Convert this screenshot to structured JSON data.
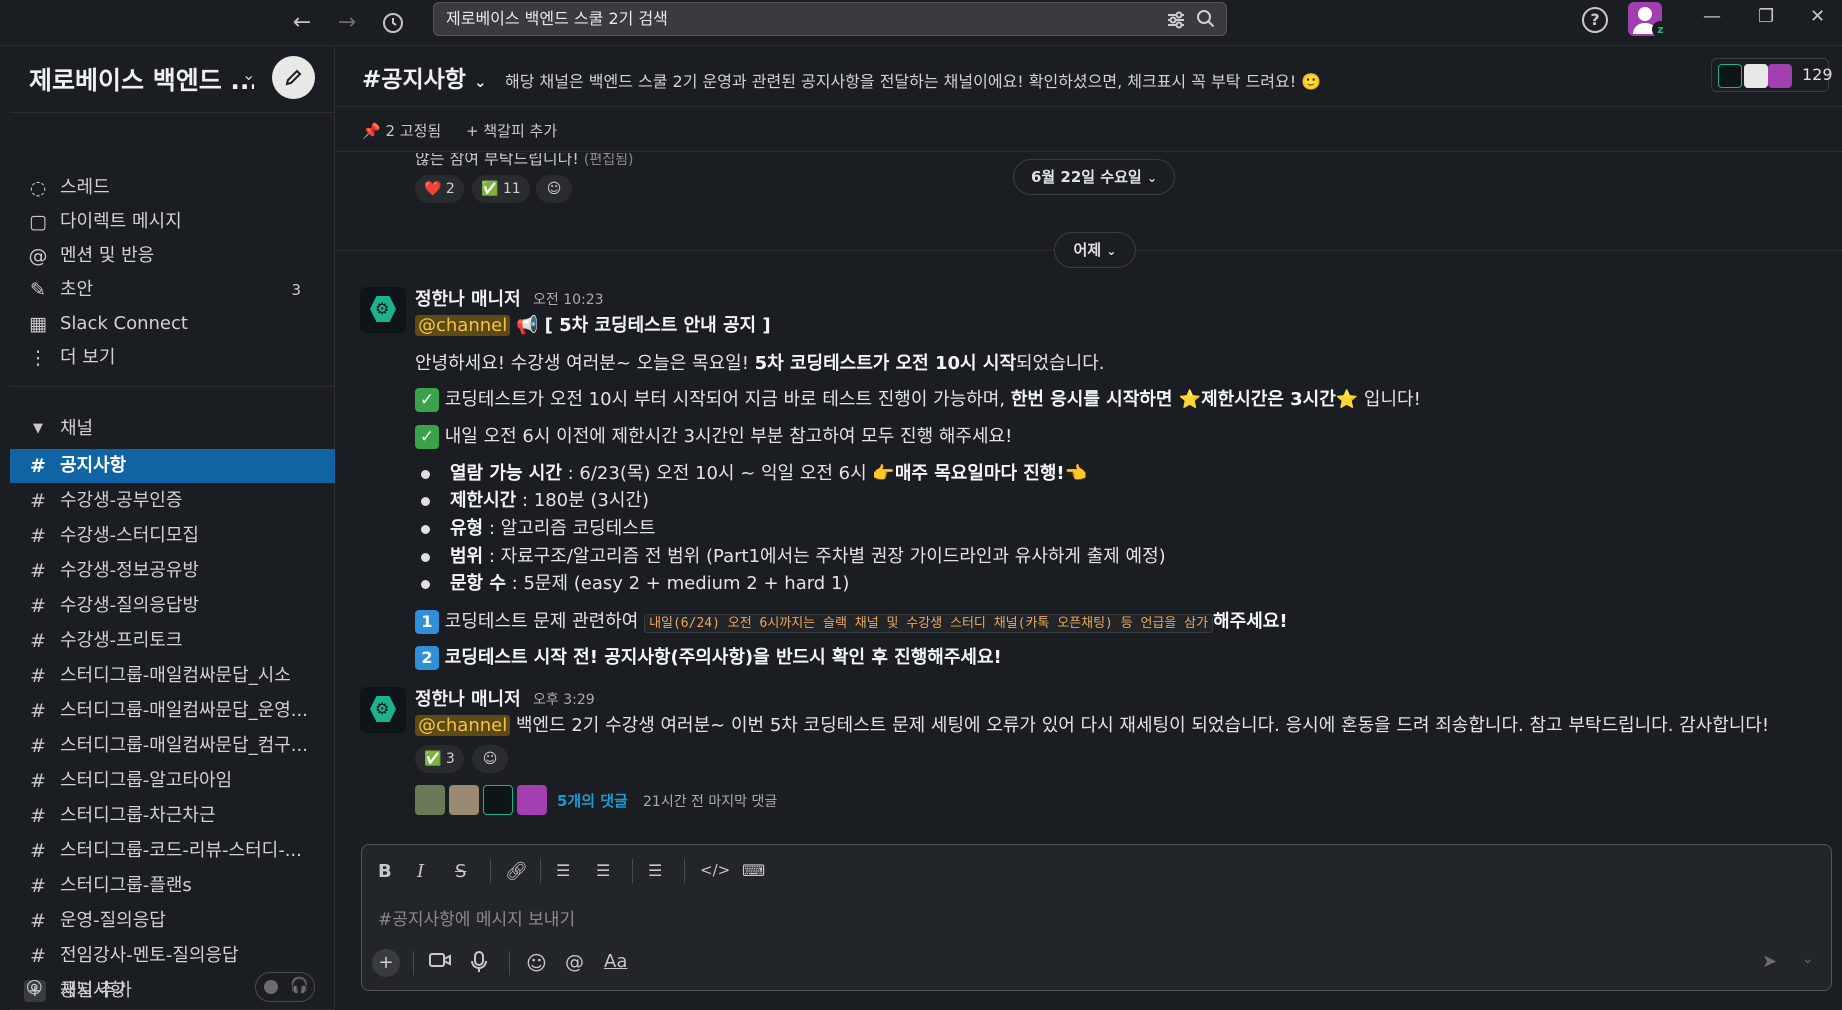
{
  "search": {
    "placeholder": "제로베이스 백엔드 스쿨 2기 검색"
  },
  "workspace": {
    "name": "제로베이스 백엔드 ..."
  },
  "sidebar": {
    "top_items": [
      {
        "label": "스레드"
      },
      {
        "label": "다이렉트 메시지"
      },
      {
        "label": "멘션 및 반응"
      },
      {
        "label": "초안",
        "count": "3"
      },
      {
        "label": "Slack Connect"
      },
      {
        "label": "더 보기"
      }
    ],
    "channels_header": "채널",
    "channels": [
      "공지사항",
      "수강생-공부인증",
      "수강생-스터디모집",
      "수강생-정보공유방",
      "수강생-질의응답방",
      "수강생-프리토크",
      "스터디그룹-매일컴싸문답_시소",
      "스터디그룹-매일컴싸문답_운영...",
      "스터디그룹-매일컴싸문답_컴구...",
      "스터디그룹-알고타아임",
      "스터디그룹-차근차근",
      "스터디그룹-코드-리뷰-스터디-...",
      "스터디그룹-플랜s",
      "운영-질의응답",
      "전임강사-멘토-질의응답"
    ],
    "add_channel": "채널 추가",
    "huddle_label": "공지사항"
  },
  "header": {
    "channel_name": "공지사항",
    "topic": "해당 채널은 백엔드 스쿨 2기 운영과 관련된 공지사항을 전달하는 채널이에요! 확인하셨으면, 체크표시 꼭 부탁 드려요! 🙂",
    "member_count": "129",
    "pinned": "2 고정됨",
    "add_bookmark": "책갈피 추가"
  },
  "messages": {
    "prev_tail": "않는 참여 부탁드립니다!",
    "prev_edited": "(편집됨)",
    "prev_reactions": [
      {
        "emoji": "❤️",
        "count": "2"
      },
      {
        "emoji": "✅",
        "count": "11"
      }
    ],
    "date_pill_1": "6월 22일 수요일",
    "date_pill_2": "어제",
    "msg1": {
      "author": "정한나 매니저",
      "time": "오전 10:23",
      "mention": "@channel",
      "title": "📢 [ 5차 코딩테스트 안내 공지 ]",
      "intro_a": "안녕하세요! 수강생 여러분~ 오늘은 목요일! ",
      "intro_b": "5차 코딩테스트가 오전 10시 시작",
      "intro_c": "되었습니다.",
      "check1_a": "코딩테스트가 오전 10시 부터 시작되어 지금 바로 테스트 진행이 가능하며, ",
      "check1_b": "한번 응시를 시작하면 ⭐제한시간은 3시간⭐",
      "check1_c": " 입니다!",
      "check2": "내일 오전 6시 이전에 제한시간 3시간인 부분 참고하여 모두 진행 해주세요!",
      "bullets": [
        {
          "k": "열람 가능 시간",
          "v": " : 6/23(목) 오전 10시 ~ 익일 오전 6시 ",
          "extra": "👉매주 목요일마다 진행!👈"
        },
        {
          "k": "제한시간",
          "v": " : 180분 (3시간)"
        },
        {
          "k": "유형",
          "v": " : 알고리즘 코딩테스트"
        },
        {
          "k": "범위",
          "v": " : 자료구조/알고리즘 전 범위 (Part1에서는 주차별 권장 가이드라인과 유사하게 출제 예정)"
        },
        {
          "k": "문항 수",
          "v": " : 5문제 (easy 2 + medium 2 + hard 1)"
        }
      ],
      "num1_key": "1",
      "num1_a": "코딩테스트 문제 관련하여 ",
      "num1_code": "내일(6/24) 오전 6시까지는 슬랙 채널 및 수강생 스터디 채널(카톡 오픈채팅) 등 언급을 삼가",
      "num1_b": "해주세요!",
      "num2_key": "2",
      "num2": "코딩테스트 시작 전! 공지사항(주의사항)을 반드시 확인 후 진행해주세요!"
    },
    "msg2": {
      "author": "정한나 매니저",
      "time": "오후 3:29",
      "mention": "@channel",
      "text": " 백엔드 2기 수강생 여러분~ 이번 5차 코딩테스트 문제 세팅에 오류가 있어 다시 재세팅이 되었습니다. 응시에 혼동을 드려 죄송합니다. 참고 부탁드립니다. 감사합니다!",
      "reaction": {
        "emoji": "✅",
        "count": "3"
      },
      "replies": "5개의 댓글",
      "last_reply": "21시간 전 마지막 댓글"
    }
  },
  "composer": {
    "placeholder": "#공지사항에 메시지 보내기"
  },
  "colors": {
    "active": "#1164a3",
    "mention_bg": "#5d4a14",
    "mention_fg": "#f2c744",
    "link": "#1d9bd1"
  }
}
